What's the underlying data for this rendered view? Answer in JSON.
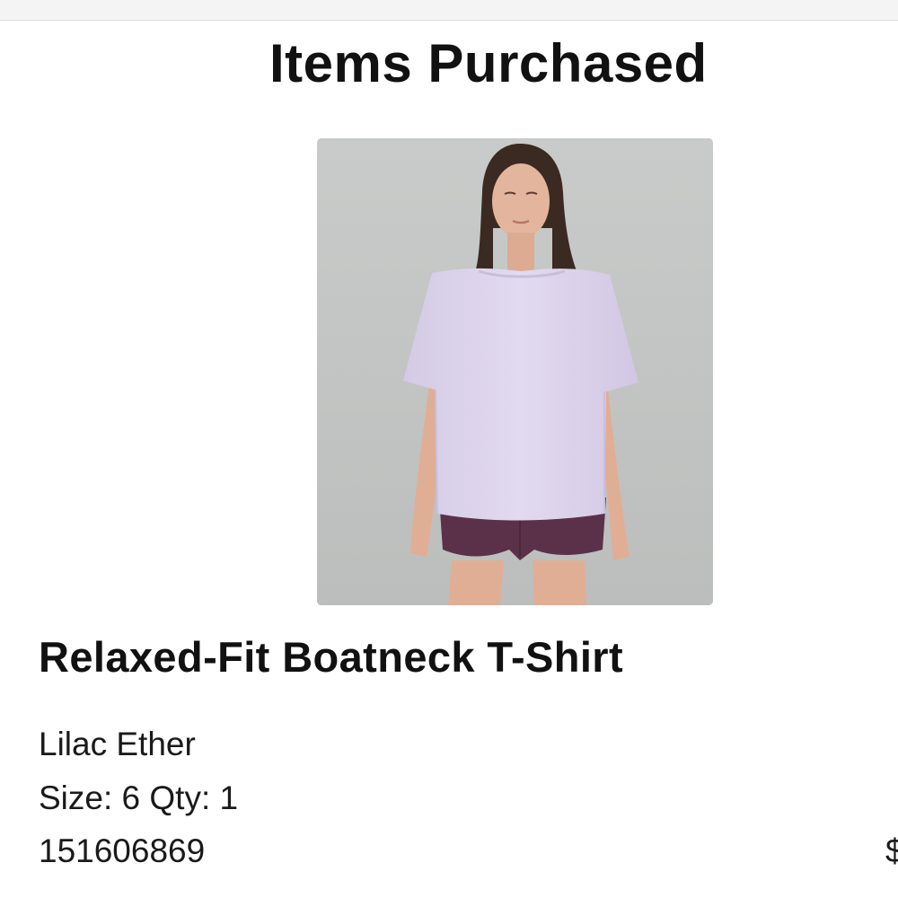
{
  "section": {
    "title": "Items Purchased"
  },
  "item": {
    "image_alt": "Relaxed-Fit Boatneck T-Shirt",
    "name": "Relaxed-Fit Boatneck T-Shirt",
    "color": "Lilac Ether",
    "size_qty": "Size: 6 Qty: 1",
    "sku": "151606869",
    "price_visible": "$"
  },
  "colors": {
    "text": "#111111",
    "image_background": "#c4c6c5",
    "shirt": "#dcd3ea",
    "shorts": "#5b3149"
  }
}
